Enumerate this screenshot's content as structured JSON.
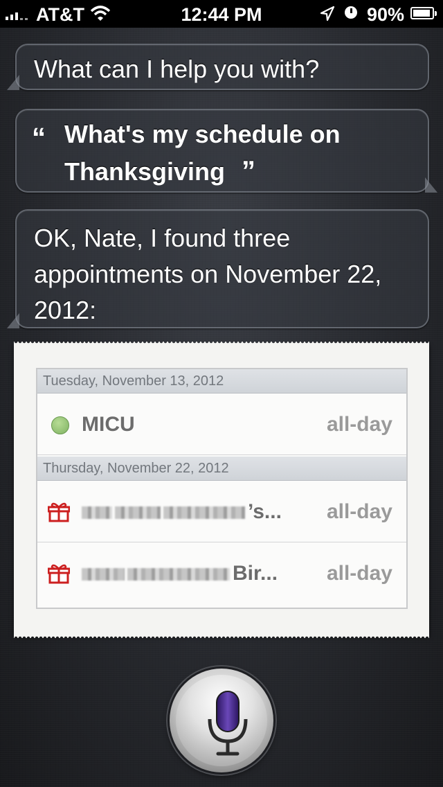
{
  "status_bar": {
    "carrier": "AT&T",
    "time": "12:44 PM",
    "battery_percent": "90%",
    "icons": [
      "signal-icon",
      "wifi-icon",
      "location-icon",
      "alarm-icon",
      "battery-icon"
    ]
  },
  "conversation": {
    "siri_prompt": "What can I help you with?",
    "user_query_line1": "What's my schedule on",
    "user_query_line2": "Thanksgiving",
    "open_quote": "“",
    "close_quote": "”",
    "siri_response": "OK, Nate, I found three appointments on November 22, 2012:"
  },
  "calendar": {
    "days": [
      {
        "date": "Tuesday, November 13, 2012",
        "events": [
          {
            "title": "MICU",
            "time": "all-day",
            "icon": "green-dot-icon"
          }
        ]
      },
      {
        "date": "Thursday, November 22, 2012",
        "events": [
          {
            "title": "’s...",
            "time": "all-day",
            "icon": "gift-icon"
          },
          {
            "title": "Bir...",
            "time": "all-day",
            "icon": "gift-icon"
          }
        ]
      }
    ]
  },
  "colors": {
    "background": "#26282d",
    "status_bar": "#000000",
    "card": "#f4f4f2",
    "event_dot": "#8fc070",
    "gift": "#cc1f1f",
    "mic_purple": "#4a2a8a"
  }
}
